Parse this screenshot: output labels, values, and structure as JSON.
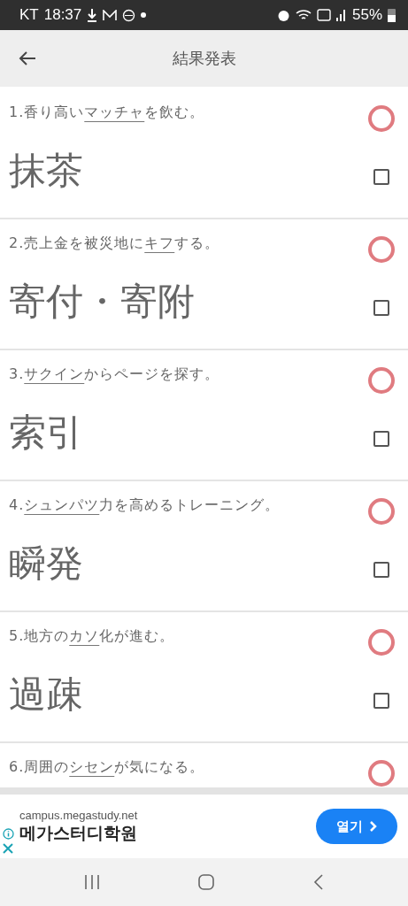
{
  "status_bar": {
    "carrier": "KT",
    "time": "18:37",
    "battery": "55%"
  },
  "header": {
    "title": "結果発表"
  },
  "questions": [
    {
      "number": "1.",
      "prefix": "香り高い",
      "target": "マッチャ",
      "suffix": "を飲む。",
      "answer": "抹茶",
      "correct": true,
      "checked": false
    },
    {
      "number": "2.",
      "prefix": "売上金を被災地に",
      "target": "キフ",
      "suffix": "する。",
      "answer": "寄付・寄附",
      "correct": true,
      "checked": false
    },
    {
      "number": "3.",
      "target": "サクイン",
      "suffix": "からページを探す。",
      "answer": "索引",
      "correct": true,
      "checked": false
    },
    {
      "number": "4.",
      "target": "シュンパツ",
      "suffix": "力を高めるトレーニング。",
      "answer": "瞬発",
      "correct": true,
      "checked": false
    },
    {
      "number": "5.",
      "prefix": "地方の",
      "target": "カソ",
      "suffix": "化が進む。",
      "answer": "過疎",
      "correct": true,
      "checked": false
    },
    {
      "number": "6.",
      "prefix": "周囲の",
      "target": "シセン",
      "suffix": "が気になる。",
      "correct": true
    }
  ],
  "ad": {
    "domain": "campus.megastudy.net",
    "name": "메가스터디학원",
    "button": "열기"
  }
}
